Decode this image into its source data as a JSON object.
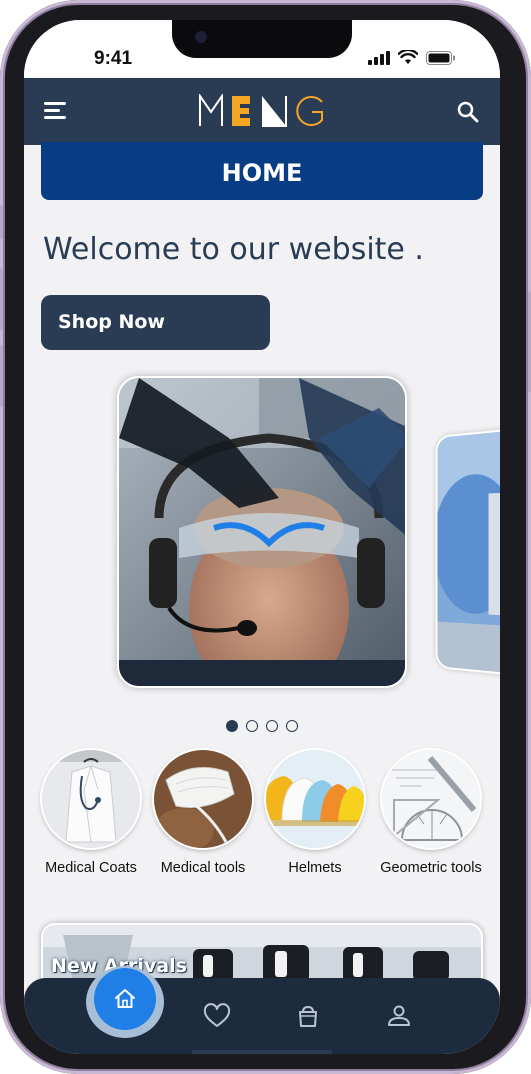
{
  "status_bar": {
    "time": "9:41"
  },
  "app_bar": {
    "logo_text": "MENG"
  },
  "home_banner": {
    "label": "HOME"
  },
  "hero": {
    "welcome_text": "Welcome to our website .",
    "shop_button_label": "Shop Now"
  },
  "carousel": {
    "slide_count": 4,
    "active_index": 0
  },
  "categories": [
    {
      "label": "Medical Coats",
      "icon": "lab-coat"
    },
    {
      "label": "Medical tools",
      "icon": "face-mask"
    },
    {
      "label": "Helmets",
      "icon": "hard-hats"
    },
    {
      "label": "Geometric tools",
      "icon": "ruler-protractor"
    }
  ],
  "new_arrivals": {
    "title": "New Arrivals"
  },
  "bottom_nav": {
    "items": [
      {
        "name": "home",
        "active": true
      },
      {
        "name": "favorites",
        "active": false
      },
      {
        "name": "cart",
        "active": false
      },
      {
        "name": "profile",
        "active": false
      }
    ]
  },
  "colors": {
    "primary_navy": "#2a3c54",
    "banner_blue": "#083c84",
    "accent_orange": "#f5a623",
    "home_button_blue": "#1f7fe6"
  }
}
